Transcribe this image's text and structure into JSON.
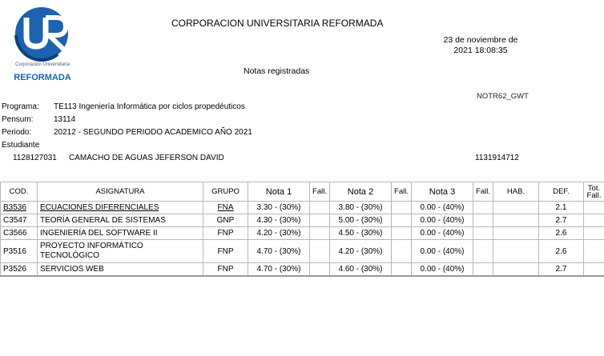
{
  "logo": {
    "subtitle": "Corporación Universitaria",
    "name": "REFORMADA"
  },
  "header": {
    "title": "CORPORACION UNIVERSITARIA REFORMADA",
    "date_line1": "23 de noviembre de",
    "date_line2": "2021 18:08:35",
    "subtitle": "Notas registradas",
    "report_code": "NOTR62_GWT"
  },
  "info": {
    "programa_label": "Programa:",
    "programa_value": "TE113  Ingeniería Informática por ciclos propedéuticos",
    "pensum_label": "Pensum:",
    "pensum_value": "13114",
    "periodo_label": "Periodo:",
    "periodo_value": "20212 - SEGUNDO PERIODO ACADEMICO AÑO 2021",
    "estudiante_label": "Estudiante",
    "student_id": "1128127031",
    "student_name": "CAMACHO DE AGUAS JEFERSON DAVID",
    "student_doc": "1131914712"
  },
  "table": {
    "headers": [
      "COD.",
      "ASIGNATURA",
      "GRUPO",
      "Nota 1",
      "Fall.",
      "Nota 2",
      "Fall.",
      "Nota 3",
      "Fall.",
      "HAB.",
      "DEF.",
      "Tot. Fall."
    ],
    "rows": [
      {
        "cod": "B3536",
        "asignatura": "ECUACIONES DIFERENCIALES",
        "grupo": "FNA",
        "nota1": "3.30 - (30%)",
        "fall1": "",
        "nota2": "3.80 - (30%)",
        "fall2": "",
        "nota3": "0.00 - (40%)",
        "fall3": "",
        "hab": "",
        "def": "2.1",
        "tot": ""
      },
      {
        "cod": "C3547",
        "asignatura": "TEORÍA GENERAL DE SISTEMAS",
        "grupo": "GNP",
        "nota1": "4.30 - (30%)",
        "fall1": "",
        "nota2": "5.00 - (30%)",
        "fall2": "",
        "nota3": "0.00 - (40%)",
        "fall3": "",
        "hab": "",
        "def": "2.7",
        "tot": ""
      },
      {
        "cod": "C3566",
        "asignatura": "INGENIERÍA DEL SOFTWARE II",
        "grupo": "FNP",
        "nota1": "4.20 - (30%)",
        "fall1": "",
        "nota2": "4.50 - (30%)",
        "fall2": "",
        "nota3": "0.00 - (40%)",
        "fall3": "",
        "hab": "",
        "def": "2.6",
        "tot": ""
      },
      {
        "cod": "P3516",
        "asignatura": "PROYECTO INFORMÁTICO TECNOLÓGICO",
        "grupo": "FNP",
        "nota1": "4.70 - (30%)",
        "fall1": "",
        "nota2": "4.20 - (30%)",
        "fall2": "",
        "nota3": "0.00 - (40%)",
        "fall3": "",
        "hab": "",
        "def": "2.6",
        "tot": ""
      },
      {
        "cod": "P3526",
        "asignatura": "SERVICIOS WEB",
        "grupo": "FNP",
        "nota1": "4.70 - (30%)",
        "fall1": "",
        "nota2": "4.60 - (30%)",
        "fall2": "",
        "nota3": "0.00 - (40%)",
        "fall3": "",
        "hab": "",
        "def": "2.7",
        "tot": ""
      }
    ]
  }
}
